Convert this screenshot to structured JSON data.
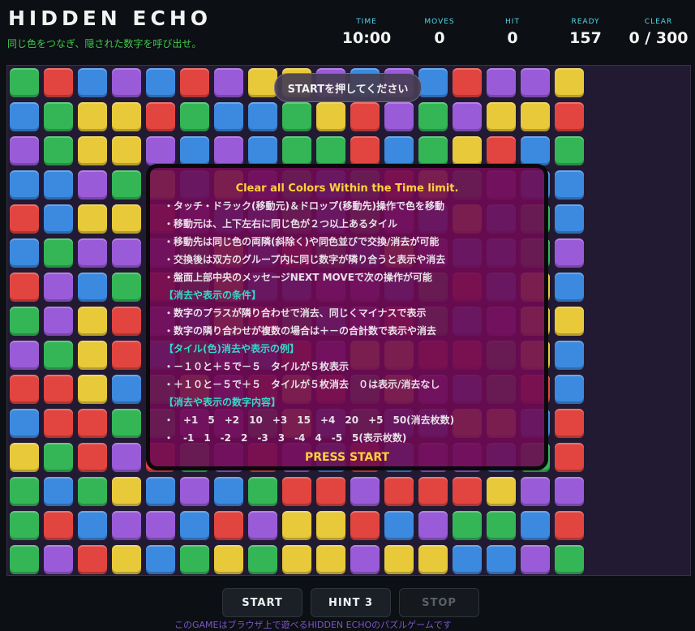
{
  "header": {
    "title": "HIDDEN ECHO",
    "subtitle": "同じ色をつなぎ、隠された数字を呼び出せ。"
  },
  "stats": [
    {
      "label": "TIME",
      "value": "10:00"
    },
    {
      "label": "MOVES",
      "value": "0"
    },
    {
      "label": "HIT",
      "value": "0"
    },
    {
      "label": "READY",
      "value": "157"
    },
    {
      "label": "CLEAR",
      "value": "0 / 300"
    }
  ],
  "board": {
    "message": "STARTを押してください",
    "colors": {
      "r": "#e2453f",
      "g": "#34b657",
      "b": "#3c8ae0",
      "y": "#e8c93a",
      "p": "#9a5bd8"
    },
    "rows": [
      "grbpbrpyypbpbrppy",
      "bgyyrgbbgyrpgpyyr",
      "pgyypbpbggrbgyrbg",
      "bbpgybypgbgrygpbb",
      "rbyyrpbbgbgpbybgb",
      "bgpppgybrgbypbbgp",
      "rpbgrgybbppbgrbyb",
      "gpyrpbyrgbprgbpyy",
      "pgyrbgpbrpyyrrgyb",
      "rrybgypryrgypbgrb",
      "brrggppgybgbbyybr",
      "ygrprgprpbrbppbgr",
      "gbgybpbgrrprrrypp",
      "grbppbrpyyrbpggbr",
      "gprybgygyypyybbpg"
    ]
  },
  "instructions": {
    "heading": "Clear all Colors Within the Time limit.",
    "lines": [
      {
        "text": "・タッチ・ドラック(移動元)＆ドロップ(移動先)操作で色を移動",
        "section": false
      },
      {
        "text": "・移動元は、上下左右に同じ色が２つ以上あるタイル",
        "section": false
      },
      {
        "text": "・移動先は同じ色の両隣(斜除く)や同色並びで交換/消去が可能",
        "section": false
      },
      {
        "text": "・交換後は双方のグループ内に同じ数字が隣り合うと表示や消去",
        "section": false
      },
      {
        "text": "・盤面上部中央のメッセージNEXT MOVEで次の操作が可能",
        "section": false
      },
      {
        "text": "【消去や表示の条件】",
        "section": true
      },
      {
        "text": "・数字のプラスが隣り合わせで消去、同じくマイナスで表示",
        "section": false
      },
      {
        "text": "・数字の隣り合わせが複数の場合は＋－の合計数で表示や消去",
        "section": false
      },
      {
        "text": "【タイル(色)消去や表示の例】",
        "section": true
      },
      {
        "text": "・－１０と＋５で－５　タイルが５枚表示",
        "section": false
      },
      {
        "text": "・＋１０と－５で＋５　タイルが５枚消去　０は表示/消去なし",
        "section": false
      },
      {
        "text": "【消去や表示の数字内容】",
        "section": true
      },
      {
        "text": "・　+1　5　+2　10　+3　15　+4　20　+5　50(消去枚数)",
        "section": false
      },
      {
        "text": "・　-1　1　-2　2　-3　3　-4　4　-5　5(表示枚数)",
        "section": false
      }
    ],
    "press": "PRESS START"
  },
  "controls": {
    "start": "START",
    "hint": "HINT 3",
    "stop": "STOP"
  },
  "footer": {
    "note": "このGAMEはブラウザ上で遊べるHIDDEN ECHOのパズルゲームです"
  }
}
